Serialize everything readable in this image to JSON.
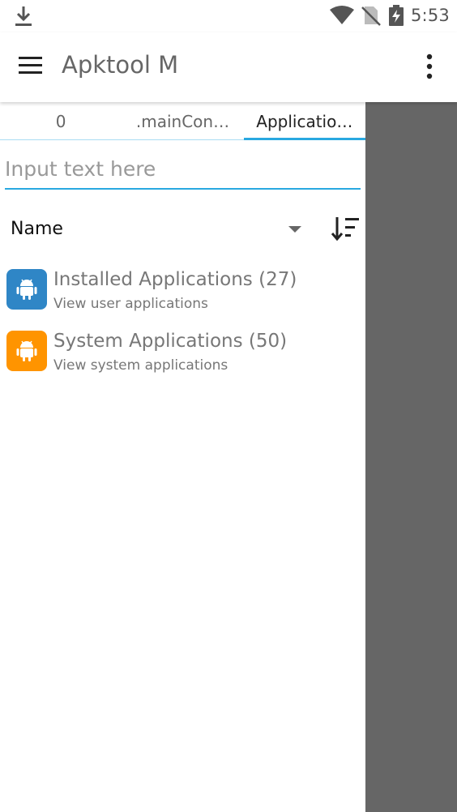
{
  "status_bar": {
    "time": "5:53",
    "icons": [
      "download-icon",
      "wifi-icon",
      "no-sim-icon",
      "battery-charging-icon"
    ]
  },
  "app_bar": {
    "title": "Apktool M",
    "menu_icon": "hamburger-menu-icon",
    "overflow_icon": "more-vert-icon"
  },
  "tabs": [
    {
      "label": "0"
    },
    {
      "label": ".mainCon…"
    },
    {
      "label": "Applicatio…",
      "active": true
    }
  ],
  "search": {
    "placeholder": "Input text here",
    "value": ""
  },
  "sort": {
    "selected": "Name",
    "dropdown_icon": "dropdown-arrow-icon",
    "order_icon": "sort-descending-icon"
  },
  "list": [
    {
      "title": "Installed Applications (27)",
      "subtitle": "View user applications",
      "icon": "android-icon",
      "color": "#2f86c6"
    },
    {
      "title": "System Applications (50)",
      "subtitle": "View system applications",
      "icon": "android-icon",
      "color": "#ff9400"
    }
  ],
  "colors": {
    "accent": "#29a8e0",
    "scrim": "#666666"
  }
}
